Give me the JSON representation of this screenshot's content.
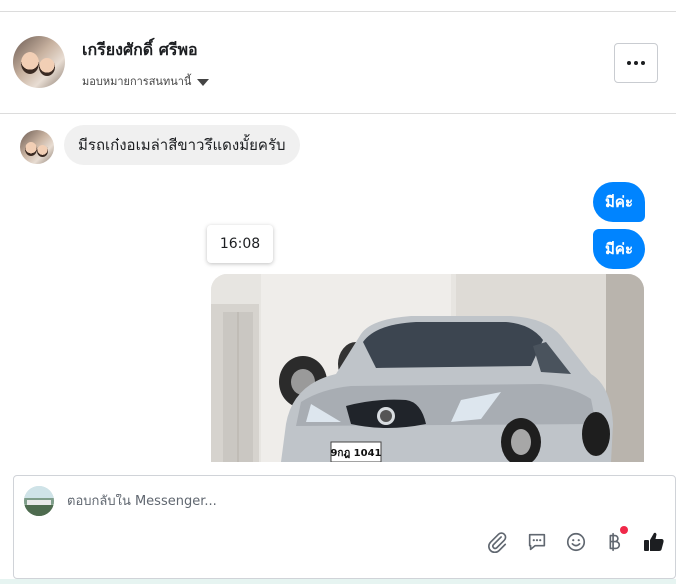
{
  "header": {
    "contact_name": "เกรียงศักดิ์ ศรีพอ",
    "assign_label": "มอบหมายการสนทนานี้",
    "more_icon": "more-horizontal-icon"
  },
  "messages": {
    "incoming": "มีรถเก๋งอเมล่าสีขาวรึแดงมั้ยครับ",
    "outgoing_1": "มีค่ะ",
    "outgoing_2": "มีค่ะ",
    "timestamp": "16:08",
    "photo_plate": "9กฎ 1041"
  },
  "composer": {
    "placeholder": "ตอบกลับใน Messenger...",
    "icons": [
      "attachment-icon",
      "saved-reply-icon",
      "emoji-icon",
      "baht-payment-icon",
      "like-icon"
    ]
  },
  "colors": {
    "accent": "#0084ff",
    "incoming_bubble": "#f0f0f0",
    "notification_dot": "#f02849"
  }
}
